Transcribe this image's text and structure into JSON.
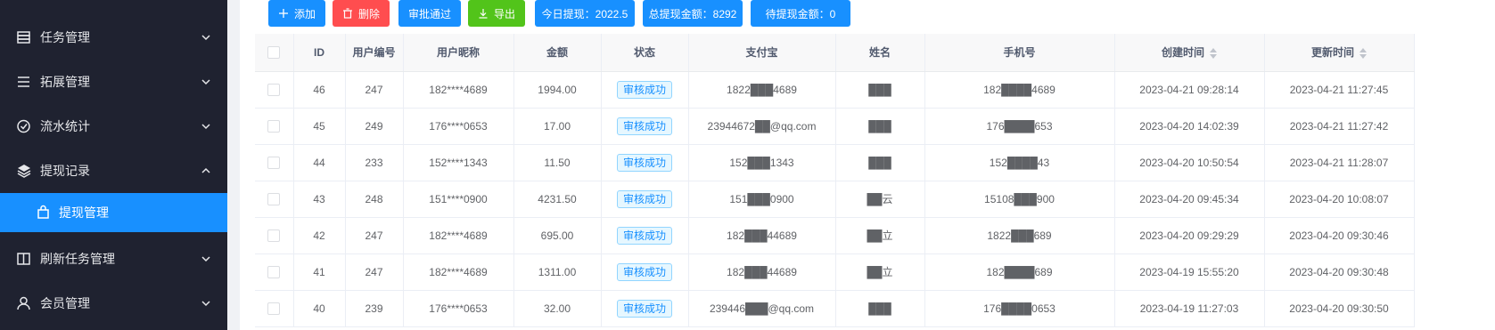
{
  "sidebar": {
    "items": [
      {
        "label": "任务管理",
        "icon": "database-icon",
        "expanded": false
      },
      {
        "label": "拓展管理",
        "icon": "list-icon",
        "expanded": false
      },
      {
        "label": "流水统计",
        "icon": "check-circle-icon",
        "expanded": false
      },
      {
        "label": "提现记录",
        "icon": "layers-icon",
        "expanded": true
      },
      {
        "label": "提现管理",
        "icon": "shopping-bag-icon",
        "active": true
      },
      {
        "label": "刷新任务管理",
        "icon": "book-icon",
        "expanded": false
      },
      {
        "label": "会员管理",
        "icon": "user-icon",
        "expanded": false
      }
    ]
  },
  "toolbar": {
    "add": "添加",
    "delete": "删除",
    "approve": "审批通过",
    "export": "导出",
    "today": "今日提现：2022.5",
    "total": "总提现金额：8292",
    "pending": "待提现金额：0"
  },
  "colors": {
    "primary": "#1890ff",
    "danger": "#ff4d4f",
    "success": "#52c41a",
    "sidebar": "#1f2230"
  },
  "table": {
    "headers": [
      "ID",
      "用户编号",
      "用户昵称",
      "金额",
      "状态",
      "支付宝",
      "姓名",
      "手机号",
      "创建时间",
      "更新时间"
    ],
    "rows": [
      {
        "id": "46",
        "uid": "247",
        "nick": "182****4689",
        "amount": "1994.00",
        "status": "审核成功",
        "alipay": "1822███4689",
        "name": "███",
        "phone": "182████4689",
        "created": "2023-04-21 09:28:14",
        "updated": "2023-04-21 11:27:45"
      },
      {
        "id": "45",
        "uid": "249",
        "nick": "176****0653",
        "amount": "17.00",
        "status": "审核成功",
        "alipay": "23944672██@qq.com",
        "name": "███",
        "phone": "176████653",
        "created": "2023-04-20 14:02:39",
        "updated": "2023-04-21 11:27:42"
      },
      {
        "id": "44",
        "uid": "233",
        "nick": "152****1343",
        "amount": "11.50",
        "status": "审核成功",
        "alipay": "152███1343",
        "name": "███",
        "phone": "152████43",
        "created": "2023-04-20 10:50:54",
        "updated": "2023-04-21 11:28:07"
      },
      {
        "id": "43",
        "uid": "248",
        "nick": "151****0900",
        "amount": "4231.50",
        "status": "审核成功",
        "alipay": "151███0900",
        "name": "██云",
        "phone": "15108███900",
        "created": "2023-04-20 09:45:34",
        "updated": "2023-04-20 10:08:07"
      },
      {
        "id": "42",
        "uid": "247",
        "nick": "182****4689",
        "amount": "695.00",
        "status": "审核成功",
        "alipay": "182███44689",
        "name": "██立",
        "phone": "1822███689",
        "created": "2023-04-20 09:29:29",
        "updated": "2023-04-20 09:30:46"
      },
      {
        "id": "41",
        "uid": "247",
        "nick": "182****4689",
        "amount": "1311.00",
        "status": "审核成功",
        "alipay": "182███44689",
        "name": "██立",
        "phone": "182████689",
        "created": "2023-04-19 15:55:20",
        "updated": "2023-04-20 09:30:48"
      },
      {
        "id": "40",
        "uid": "239",
        "nick": "176****0653",
        "amount": "32.00",
        "status": "审核成功",
        "alipay": "239446███@qq.com",
        "name": "███",
        "phone": "176████0653",
        "created": "2023-04-19 11:27:03",
        "updated": "2023-04-20 09:30:50"
      }
    ]
  }
}
